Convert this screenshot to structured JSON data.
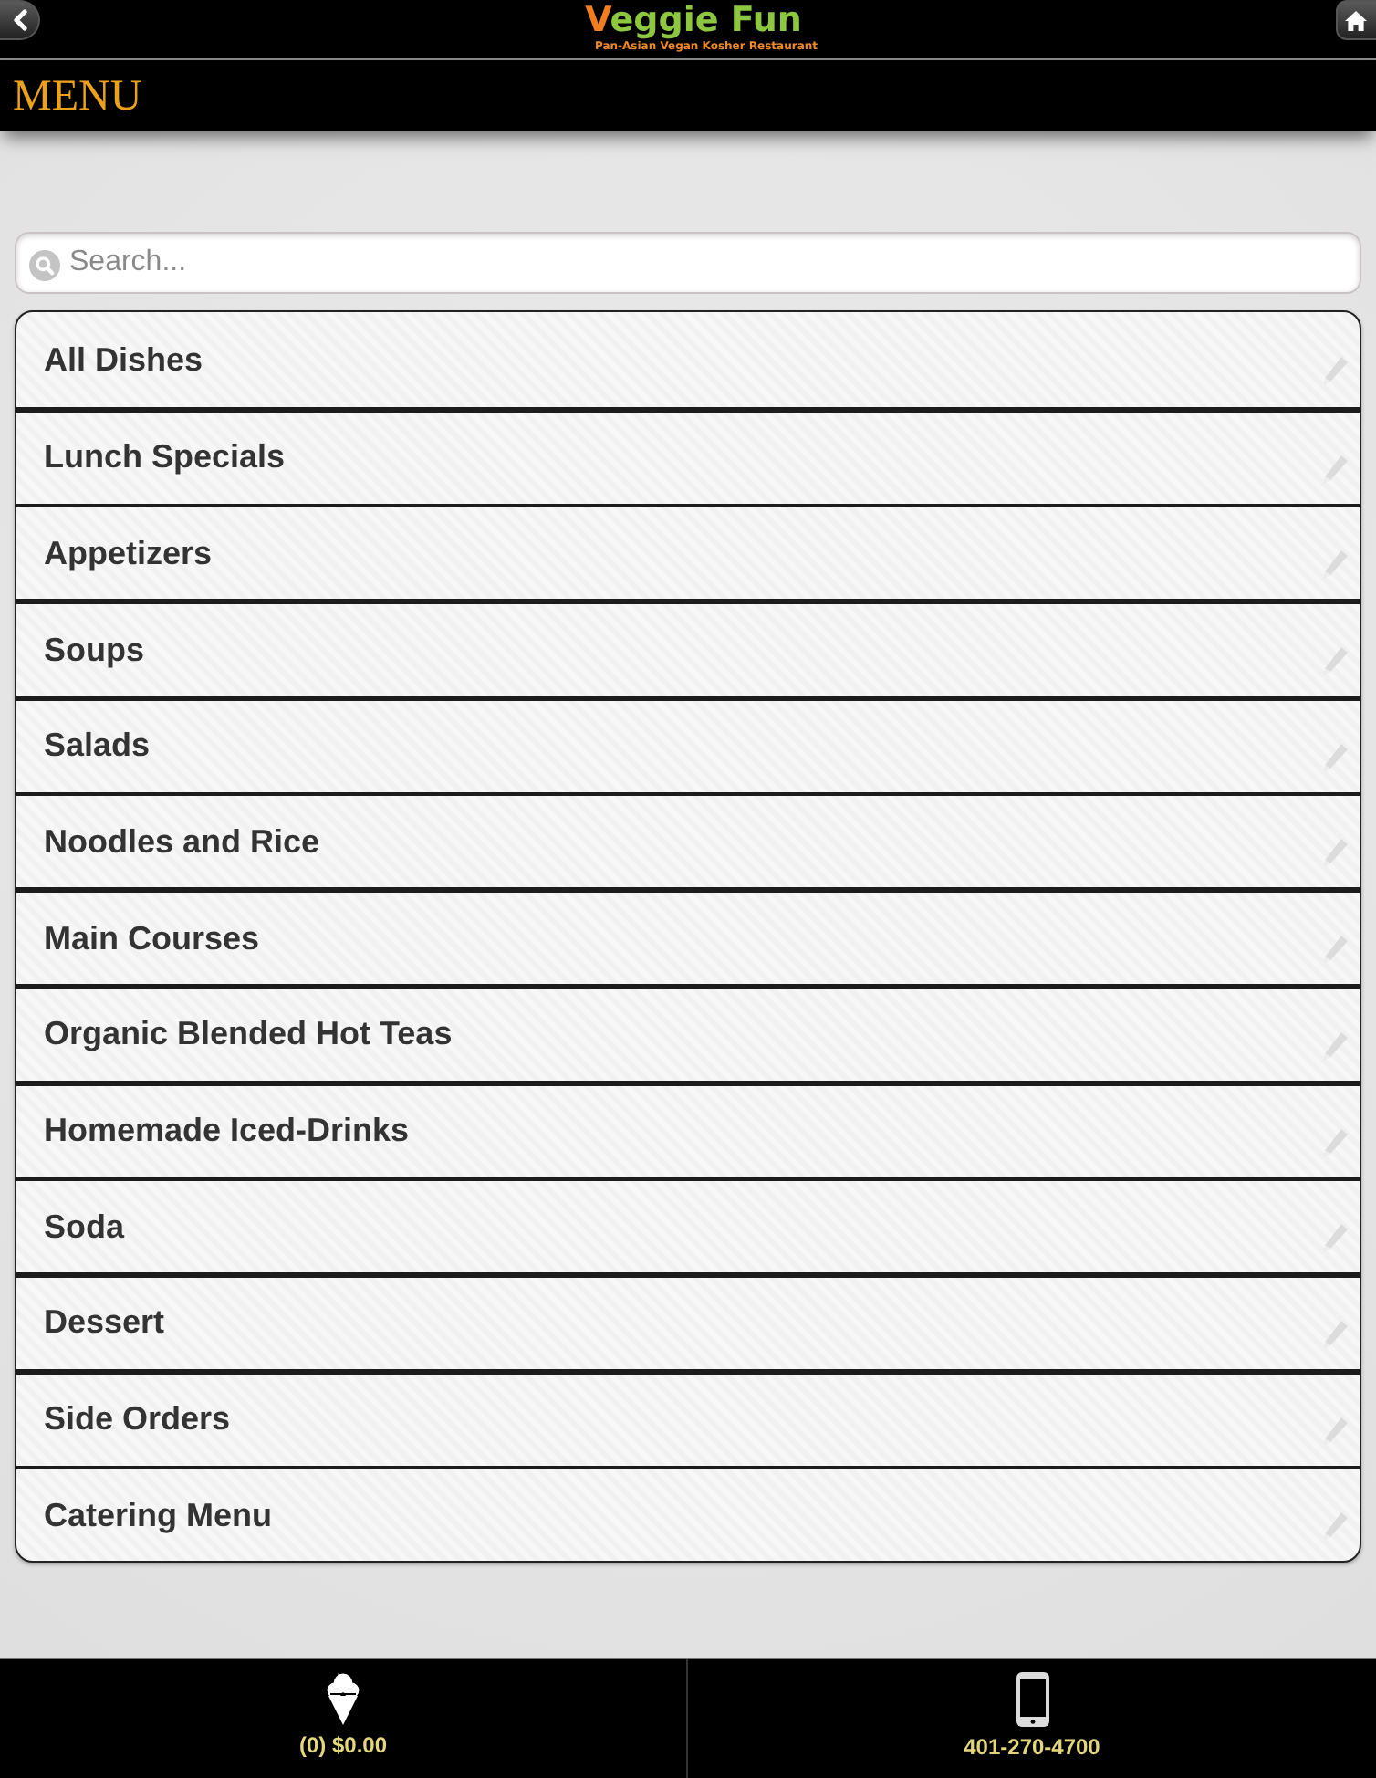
{
  "header": {
    "logo_title": "Veggie Fun",
    "logo_subtitle": "Pan-Asian Vegan Kosher Restaurant"
  },
  "title_bar": {
    "title": "MENU"
  },
  "search": {
    "placeholder": "Search..."
  },
  "categories": [
    {
      "label": "All Dishes"
    },
    {
      "label": "Lunch Specials"
    },
    {
      "label": "Appetizers"
    },
    {
      "label": "Soups"
    },
    {
      "label": "Salads"
    },
    {
      "label": "Noodles and Rice"
    },
    {
      "label": "Main Courses"
    },
    {
      "label": "Organic Blended Hot Teas"
    },
    {
      "label": "Homemade Iced-Drinks"
    },
    {
      "label": "Soda"
    },
    {
      "label": "Dessert"
    },
    {
      "label": "Side Orders"
    },
    {
      "label": "Catering Menu"
    }
  ],
  "footer": {
    "cart_summary": "(0) $0.00",
    "phone": "401-270-4700"
  }
}
